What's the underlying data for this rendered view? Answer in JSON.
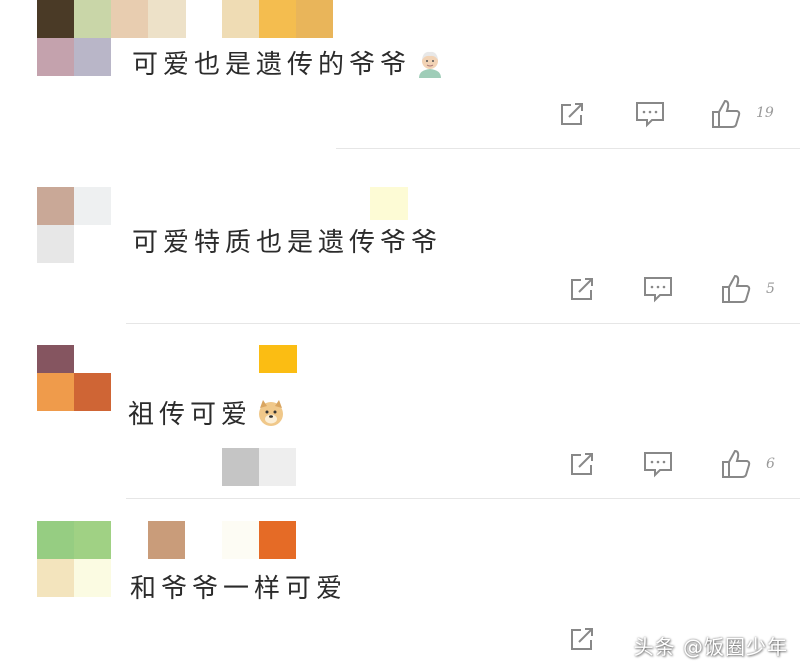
{
  "comments": [
    {
      "text": "可爱也是遗传的爷爷",
      "emoji": "old-man-emoji",
      "likes": "19"
    },
    {
      "text": "可爱特质也是遗传爷爷",
      "emoji": "",
      "likes": "5"
    },
    {
      "text": "祖传可爱",
      "emoji": "doge-emoji",
      "likes": "6"
    },
    {
      "text": "和爷爷一样可爱",
      "emoji": "",
      "likes": ""
    }
  ],
  "watermark": "头条 @饭圈少年",
  "icons": {
    "share": "share-icon",
    "comment": "comment-icon",
    "like": "thumbs-up-icon"
  },
  "colors": {
    "icon": "#888888",
    "divider": "#e6e6e6",
    "text": "#2b2b2b",
    "likes": "#999999"
  }
}
